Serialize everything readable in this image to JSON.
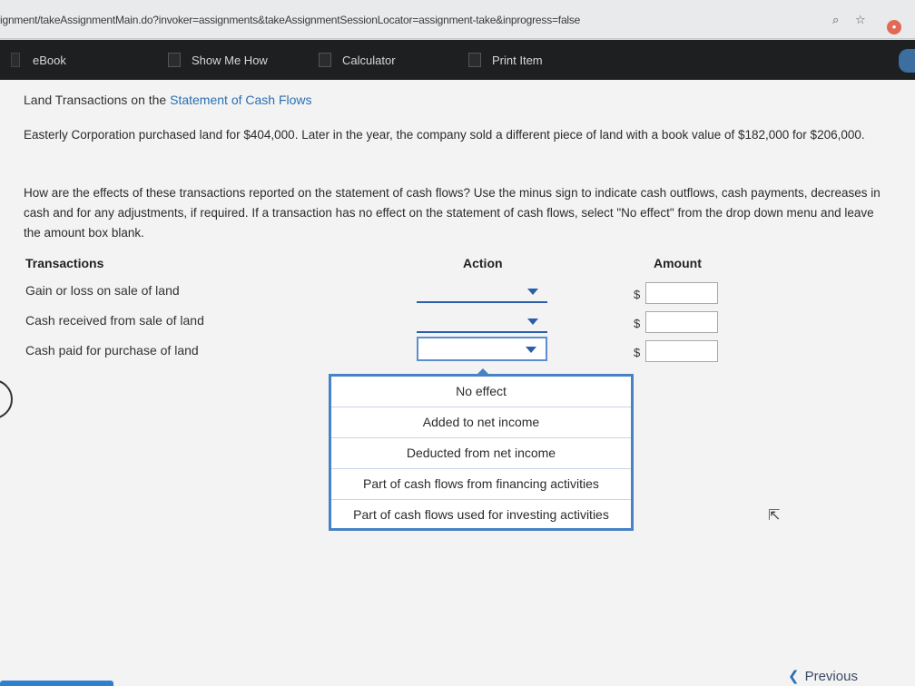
{
  "browser": {
    "url": "ignment/takeAssignmentMain.do?invoker=assignments&takeAssignmentSessionLocator=assignment-take&inprogress=false"
  },
  "toolbar": {
    "ebook": "eBook",
    "show_me_how": "Show Me How",
    "calculator": "Calculator",
    "print_item": "Print Item"
  },
  "question": {
    "title_part1": "Land Transactions on the ",
    "title_part2": "Statement of Cash Flows",
    "paragraph1": "Easterly Corporation purchased land for $404,000. Later in the year, the company sold a different piece of land with a book value of $182,000 for $206,000.",
    "paragraph2": "How are the effects of these transactions reported on the statement of cash flows? Use the minus sign to indicate cash outflows, cash payments, decreases in cash and for any adjustments, if required. If a transaction has no effect on the statement of cash flows, select \"No effect\" from the drop down menu and leave the amount box blank."
  },
  "table": {
    "headers": {
      "transactions": "Transactions",
      "action": "Action",
      "amount": "Amount"
    },
    "currency": "$",
    "rows": [
      {
        "label": "Gain or loss on sale of land",
        "action": "",
        "amount": ""
      },
      {
        "label": "Cash received from sale of land",
        "action": "",
        "amount": ""
      },
      {
        "label": "Cash paid for purchase of land",
        "action": "",
        "amount": ""
      }
    ]
  },
  "dropdown": {
    "options": [
      "No effect",
      "Added to net income",
      "Deducted from net income",
      "Part of cash flows from financing activities",
      "Part of cash flows used for investing activities"
    ]
  },
  "nav": {
    "previous": "Previous"
  }
}
